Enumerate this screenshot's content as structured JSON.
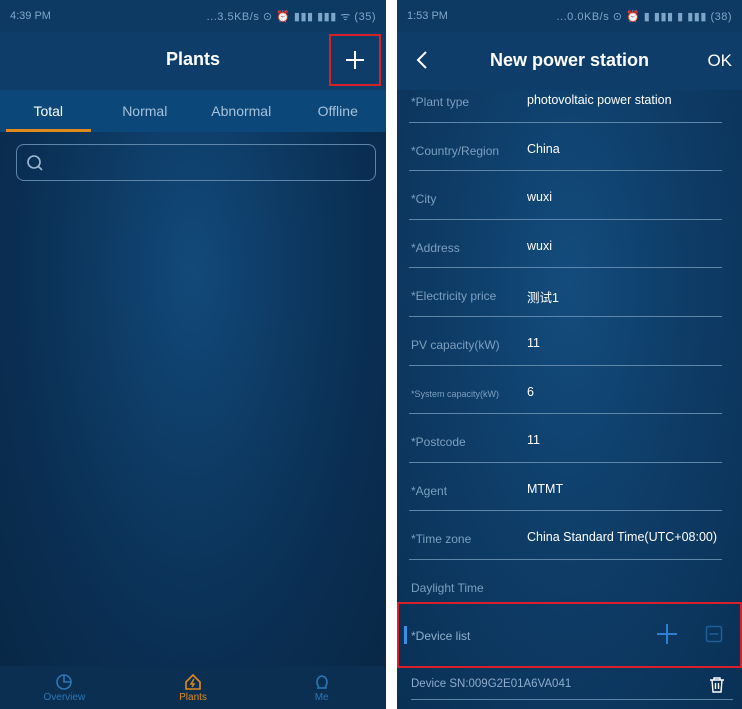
{
  "left": {
    "status": {
      "time": "4:39 PM",
      "indicators": "...3.5KB/s ⊙ ⏰ ▮▮▮ ▮▮▮ ᯤ (35)"
    },
    "header": {
      "title": "Plants",
      "add_icon": "plus-icon"
    },
    "tabs": [
      {
        "label": "Total",
        "active": true
      },
      {
        "label": "Normal",
        "active": false
      },
      {
        "label": "Abnormal",
        "active": false
      },
      {
        "label": "Offline",
        "active": false
      }
    ],
    "search": {
      "icon": "search-icon",
      "value": ""
    },
    "bottom_nav": [
      {
        "label": "Overview",
        "icon": "pie-chart-icon",
        "active": false
      },
      {
        "label": "Plants",
        "icon": "home-bolt-icon",
        "active": true
      },
      {
        "label": "Me",
        "icon": "user-icon",
        "active": false
      }
    ]
  },
  "right": {
    "status": {
      "time": "1:53 PM",
      "indicators": "...0.0KB/s ⊙ ⏰ ▮ ▮▮▮ ▮ ▮▮▮ (38)"
    },
    "header": {
      "back_icon": "chevron-left-icon",
      "title": "New power station",
      "ok": "OK"
    },
    "fields": [
      {
        "label": "*Plant type",
        "value": "photovoltaic power station"
      },
      {
        "label": "*Country/Region",
        "value": "China"
      },
      {
        "label": "*City",
        "value": "wuxi"
      },
      {
        "label": "*Address",
        "value": "wuxi"
      },
      {
        "label": "*Electricity price",
        "value": "测试1"
      },
      {
        "label": "PV capacity(kW)",
        "value": "11"
      },
      {
        "label": "*System capacity(kW)",
        "value": "6"
      },
      {
        "label": "*Postcode",
        "value": "11"
      },
      {
        "label": "*Agent",
        "value": "MTMT"
      },
      {
        "label": "*Time zone",
        "value": "China Standard Time(UTC+08:00)"
      },
      {
        "label": "Daylight Time",
        "value": ""
      }
    ],
    "device_list": {
      "label": "*Device list",
      "add_icon": "plus-icon",
      "remove_icon": "minus-box-icon"
    },
    "device": {
      "sn": "Device SN:009G2E01A6VA041",
      "delete_icon": "trash-icon"
    }
  },
  "colors": {
    "accent": "#e08a1e",
    "highlight": "#d8202a",
    "background": "#0d3a63",
    "label": "#7c9fbf"
  }
}
